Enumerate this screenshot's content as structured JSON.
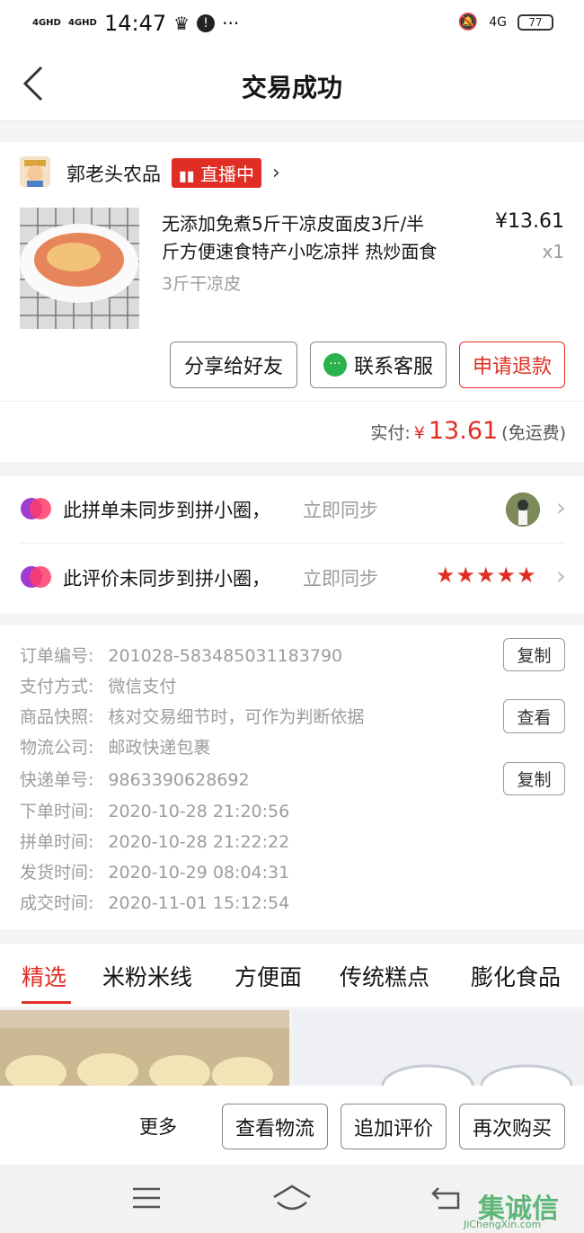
{
  "status_bar": {
    "signal1": "4GHD",
    "signal2": "4GHD",
    "time": "14:47",
    "battery": "77",
    "network": "4G"
  },
  "header": {
    "title": "交易成功"
  },
  "shop": {
    "name": "郭老头农品",
    "live_badge": "直播中"
  },
  "product": {
    "title_line1": "无添加免煮5斤干凉皮面皮3斤/半",
    "title_line2": "斤方便速食特产小吃凉拌 热炒面食",
    "spec": "3斤干凉皮",
    "price": "¥13.61",
    "qty": "x1"
  },
  "actions": {
    "share": "分享给好友",
    "service": "联系客服",
    "refund": "申请退款"
  },
  "payment": {
    "label": "实付:",
    "currency": "¥",
    "amount": "13.61",
    "note": "(免运费)"
  },
  "sync": [
    {
      "text": "此拼单未同步到拼小圈，",
      "link": "立即同步"
    },
    {
      "text": "此评价未同步到拼小圈，",
      "link": "立即同步"
    }
  ],
  "order_info": [
    {
      "label": "订单编号:",
      "value": "201028-583485031183790",
      "button": "复制"
    },
    {
      "label": "支付方式:",
      "value": "微信支付"
    },
    {
      "label": "商品快照:",
      "value": "核对交易细节时，可作为判断依据",
      "button": "查看"
    },
    {
      "label": "物流公司:",
      "value": "邮政快递包裹"
    },
    {
      "label": "快递单号:",
      "value": "9863390628692",
      "button": "复制"
    },
    {
      "label": "下单时间:",
      "value": "2020-10-28 21:20:56"
    },
    {
      "label": "拼单时间:",
      "value": "2020-10-28 21:22:22"
    },
    {
      "label": "发货时间:",
      "value": "2020-10-29 08:04:31"
    },
    {
      "label": "成交时间:",
      "value": "2020-11-01 15:12:54"
    }
  ],
  "tabs": [
    "精选",
    "米粉米线",
    "方便面",
    "传统糕点",
    "膨化食品"
  ],
  "bottom": {
    "more": "更多",
    "logistics": "查看物流",
    "review": "追加评价",
    "rebuy": "再次购买"
  },
  "rating": {
    "stars": 5
  },
  "watermark": "JiChengXin.com",
  "colors": {
    "accent": "#e02e24",
    "text": "#151516",
    "muted": "#9c9c9c"
  }
}
